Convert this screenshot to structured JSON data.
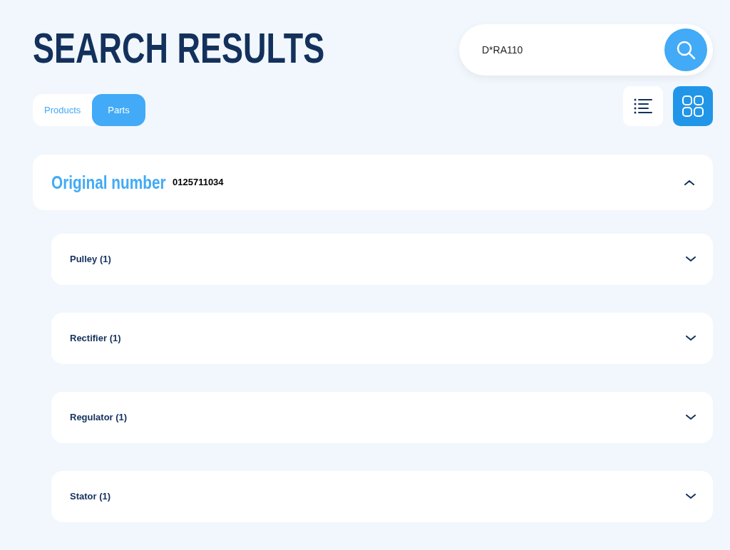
{
  "page": {
    "title": "SEARCH RESULTS"
  },
  "search": {
    "value": "D*RA110"
  },
  "tabs": [
    {
      "label": "Products",
      "selected": false
    },
    {
      "label": "Parts",
      "selected": true
    }
  ],
  "view_modes": [
    {
      "kind": "list",
      "selected": false
    },
    {
      "kind": "grid",
      "selected": true
    }
  ],
  "group": {
    "label": "Original number",
    "number": "0125711034",
    "expanded": true,
    "items": [
      {
        "label": "Pulley (1)",
        "expanded": false
      },
      {
        "label": "Rectifier (1)",
        "expanded": false
      },
      {
        "label": "Regulator (1)",
        "expanded": false
      },
      {
        "label": "Stator (1)",
        "expanded": false
      }
    ]
  }
}
